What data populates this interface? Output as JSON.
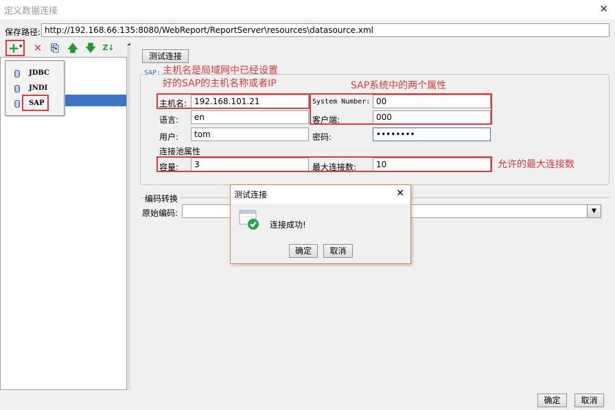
{
  "window": {
    "title": "定义数据连接",
    "close_glyph": "✕"
  },
  "path": {
    "label": "保存路径:",
    "value": "http://192.168.66.135:8080/WebReport/ReportServer\\resources\\datasource.xml"
  },
  "toolbar": {
    "add_icon": "+",
    "add_dropdown": "▾",
    "delete_icon": "✕",
    "copy_icon": "⎘",
    "up_icon": "🡅",
    "down_icon": "🡇",
    "sort_icon": "Z↓",
    "collapse_icon": "◂"
  },
  "add_menu": {
    "items": [
      {
        "label": "JDBC"
      },
      {
        "label": "JNDI"
      },
      {
        "label": "SAP"
      }
    ]
  },
  "form": {
    "test_button": "测试连接",
    "section_label": "SAP:",
    "host_label": "主机名:",
    "host_value": "192.168.101.21",
    "sysnum_label": "System Number:",
    "sysnum_value": "00",
    "lang_label": "语言:",
    "lang_value": "en",
    "client_label": "客户端:",
    "client_value": "000",
    "user_label": "用户:",
    "user_value": "tom",
    "password_label": "密码:",
    "password_value": "••••••••",
    "pool_label": "连接池属性",
    "capacity_label": "容量:",
    "capacity_value": "3",
    "maxconn_label": "最大连接数:",
    "maxconn_value": "10",
    "encoding_section": "编码转换",
    "encoding_label": "原始编码:",
    "encoding_value": "",
    "encoding_arrow": "▼"
  },
  "annotations": {
    "host_note_line1": "主机名是局域网中已经设置",
    "host_note_line2": "好的SAP的主机名称或者IP",
    "sap_note": "SAP系统中的两个属性",
    "maxconn_note": "允许的最大连接数"
  },
  "dialog": {
    "title": "测试连接",
    "close_glyph": "✕",
    "message": "连接成功!",
    "ok_label": "确定",
    "cancel_label": "取消"
  },
  "footer": {
    "ok_label": "确定",
    "cancel_label": "取消"
  },
  "colors": {
    "accent_red": "#e03a3a",
    "selection_blue": "#3b75c7",
    "dialog_border": "#e0803a",
    "success_green": "#22a646"
  }
}
